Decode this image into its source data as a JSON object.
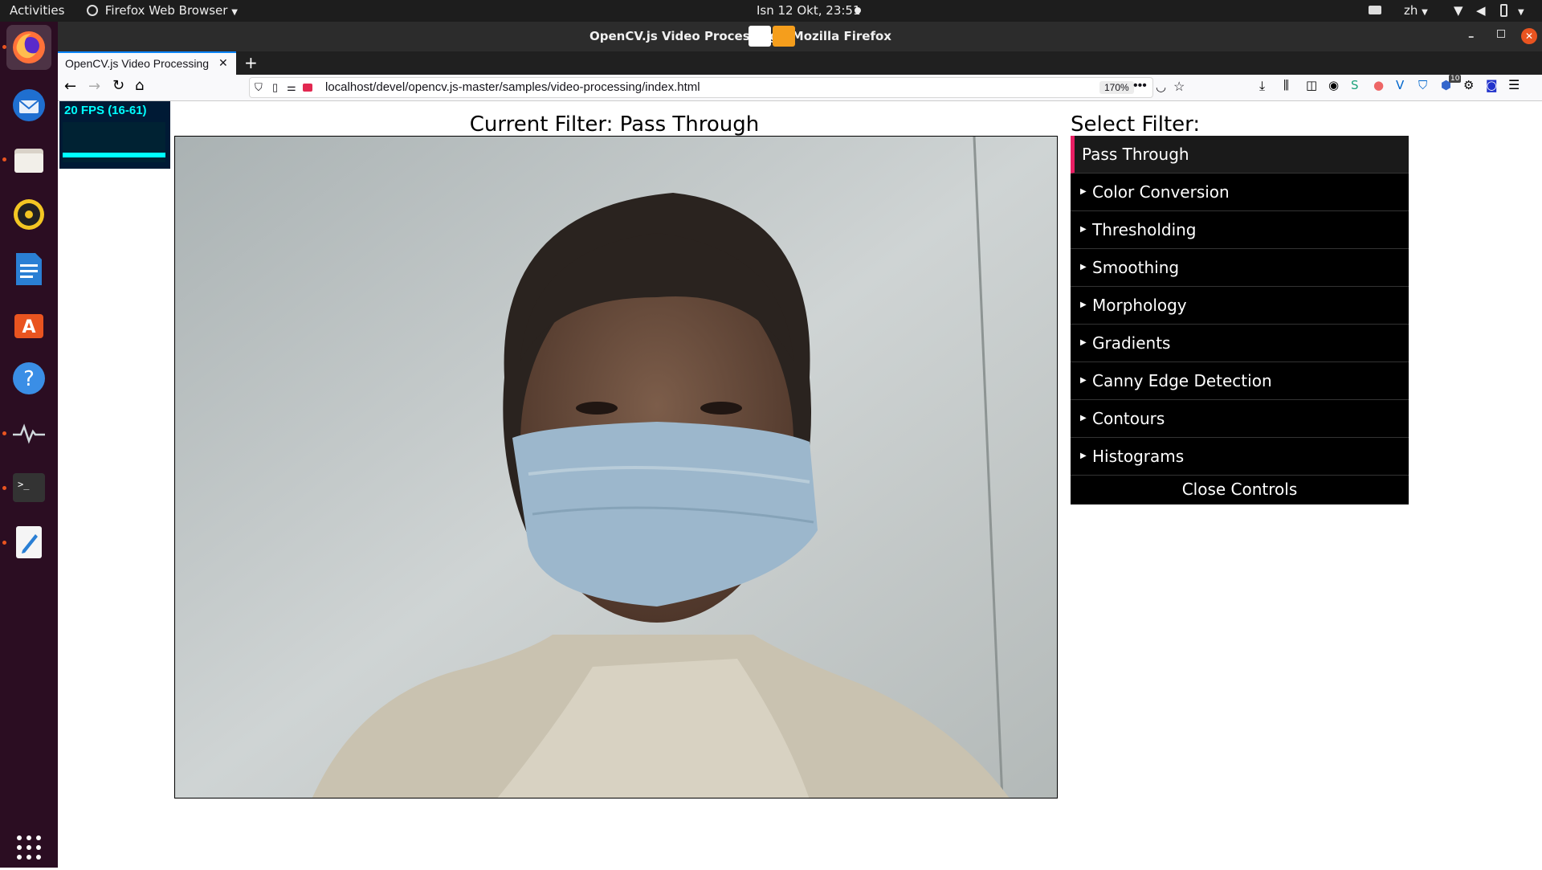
{
  "topbar": {
    "activities": "Activities",
    "app_menu": "Firefox Web Browser",
    "clock": "Isn 12 Okt, 23:51",
    "lang": "zh"
  },
  "window": {
    "title": "OpenCV.js Video Processing - Mozilla Firefox"
  },
  "tabs": [
    {
      "label": "OpenCV.js Video Processing"
    }
  ],
  "navbar": {
    "url": "localhost/devel/opencv.js-master/samples/video-processing/index.html",
    "zoom": "170%",
    "badge_count": "10"
  },
  "page": {
    "fps_label": "20 FPS (16-61)",
    "current_filter": "Current Filter: Pass Through",
    "select_filter": "Select Filter:",
    "filters": [
      {
        "label": "Pass Through"
      },
      {
        "label": "Color Conversion"
      },
      {
        "label": "Thresholding"
      },
      {
        "label": "Smoothing"
      },
      {
        "label": "Morphology"
      },
      {
        "label": "Gradients"
      },
      {
        "label": "Canny Edge Detection"
      },
      {
        "label": "Contours"
      },
      {
        "label": "Histograms"
      }
    ],
    "close_controls": "Close Controls"
  },
  "colors": {
    "selected_accent": "#e91e63",
    "dock_bg": "#2b0d22",
    "fps_text": "#00ffff"
  }
}
